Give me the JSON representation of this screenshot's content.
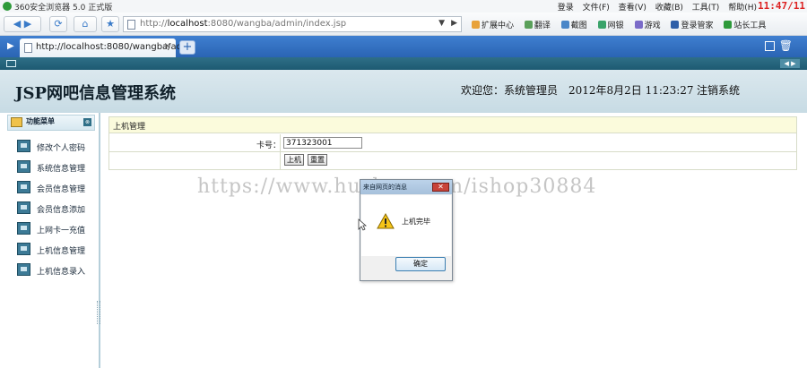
{
  "browser": {
    "app_title": "360安全浏览器 5.0 正式版",
    "menu": [
      "登录",
      "文件(F)",
      "查看(V)",
      "收藏(B)",
      "工具(T)",
      "帮助(H)"
    ],
    "clock": "11:47/11",
    "nav": {
      "back": "◀",
      "forward": "▶",
      "refresh": "⟳",
      "home": "⌂",
      "favorite": "★"
    },
    "address": {
      "prefix": "http://",
      "host": "localhost",
      "rest": ":8080/wangba/admin/index.jsp"
    },
    "tools": [
      "扩展中心",
      "翻译",
      "截图",
      "网银",
      "游戏",
      "登录管家",
      "站长工具"
    ],
    "tab": {
      "title": "http://localhost:8080/wangba/ad...",
      "close": "×"
    },
    "new_tab": "+"
  },
  "page": {
    "system_title": "JSP网吧信息管理系统",
    "welcome": "欢迎您：系统管理员　2012年8月2日 11:23:27",
    "logout": "注销系统",
    "sidebar": {
      "header_title": "功能菜单",
      "items": [
        {
          "label": "修改个人密码"
        },
        {
          "label": "系统信息管理"
        },
        {
          "label": "会员信息管理"
        },
        {
          "label": "会员信息添加"
        },
        {
          "label": "上网卡一充值"
        },
        {
          "label": "上机信息管理"
        },
        {
          "label": "上机信息录入"
        }
      ]
    },
    "panel": {
      "title": "上机管理",
      "card_label": "卡号：",
      "card_value": "371323001",
      "submit_label": "上机",
      "reset_label": "重置"
    },
    "watermark": "https://www.huzhan.com/ishop30884",
    "dialog": {
      "title": "来自网页的消息",
      "message": "上机完毕",
      "ok_label": "确定",
      "close": "✕"
    }
  }
}
